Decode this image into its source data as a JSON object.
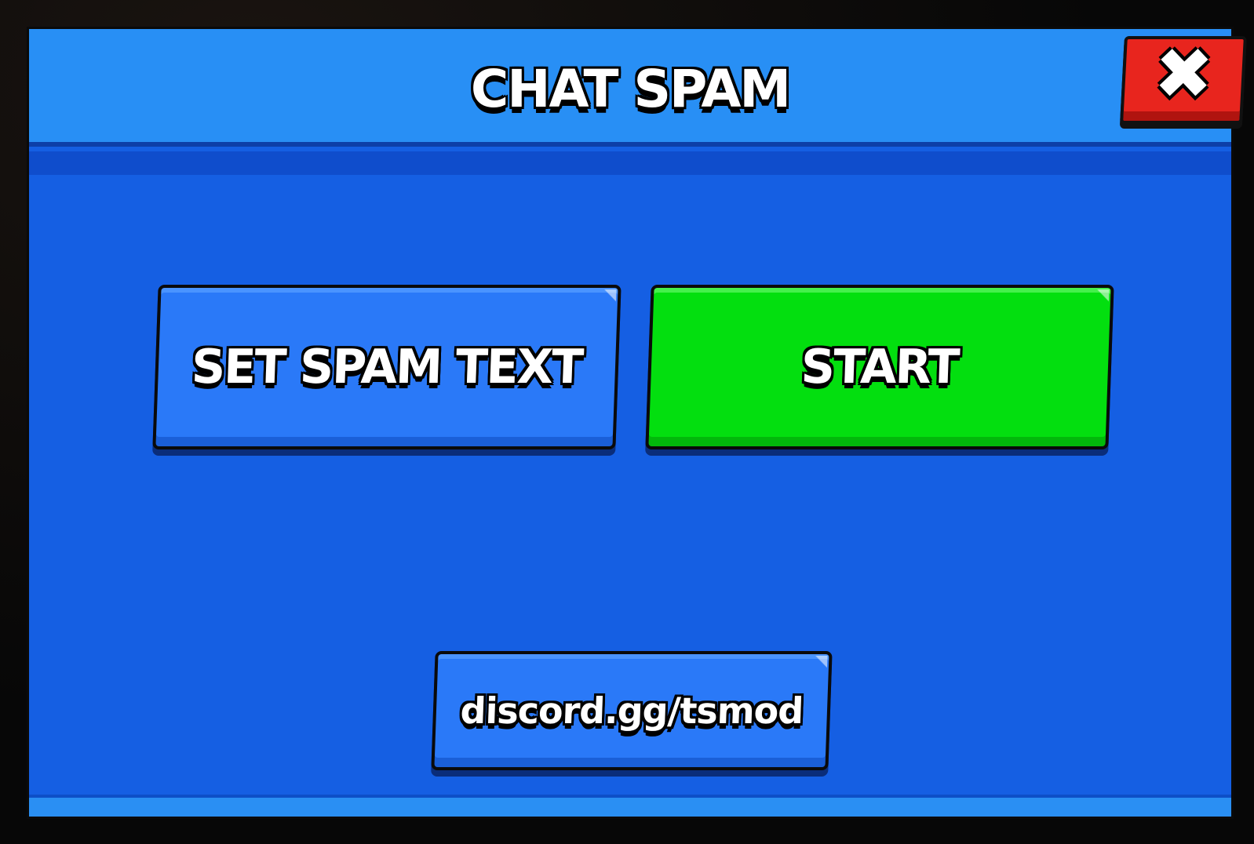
{
  "dialog": {
    "title": "CHAT SPAM",
    "close_icon": "close-x-icon"
  },
  "actions": {
    "set_spam_text_label": "SET SPAM TEXT",
    "start_label": "START",
    "discord_label": "discord.gg/tsmod"
  },
  "colors": {
    "panel": "#155fe3",
    "header": "#288ff5",
    "blue_button": "#2a79f8",
    "green_button": "#03df0f",
    "close_button": "#e8251e"
  }
}
